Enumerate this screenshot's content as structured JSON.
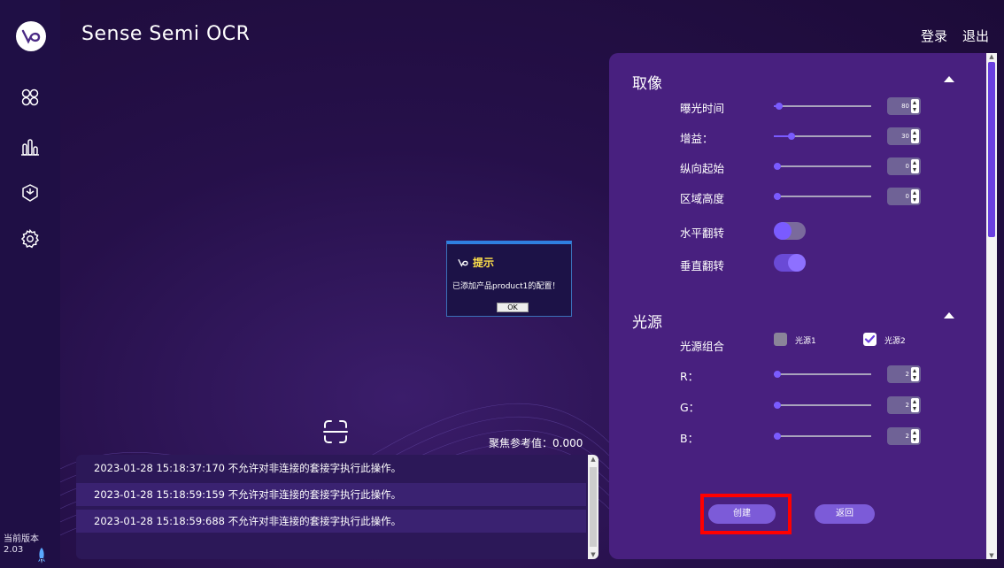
{
  "header": {
    "title": "Sense Semi OCR",
    "login": "登录",
    "logout": "退出"
  },
  "sidebar": {
    "items": [
      {
        "name": "dashboard",
        "icon": "clover-icon"
      },
      {
        "name": "statistics",
        "icon": "bar-chart-icon"
      },
      {
        "name": "products",
        "icon": "box-icon"
      },
      {
        "name": "settings",
        "icon": "gear-icon"
      }
    ],
    "version_label": "当前版本",
    "version": "2.03"
  },
  "dialog": {
    "title": "提示",
    "message": "已添加产品product1的配置！",
    "ok": "OK"
  },
  "focus": {
    "label": "聚焦参考值：0.000"
  },
  "log": {
    "rows": [
      "2023-01-28 15:18:37:170  不允许对非连接的套接字执行此操作。",
      "2023-01-28 15:18:59:159  不允许对非连接的套接字执行此操作。",
      "2023-01-28 15:18:59:688  不允许对非连接的套接字执行此操作。"
    ]
  },
  "panel": {
    "capture": {
      "title": "取像",
      "rows": [
        {
          "label": "曝光时间",
          "value": "80",
          "level": 0.02
        },
        {
          "label": "增益：",
          "value": "30",
          "level": 0.15
        },
        {
          "label": "纵向起始",
          "value": "0",
          "level": 0.0
        },
        {
          "label": "区域高度",
          "value": "0",
          "level": 0.0
        }
      ],
      "flip_h": {
        "label": "水平翻转",
        "on": false
      },
      "flip_v": {
        "label": "垂直翻转",
        "on": true
      }
    },
    "light": {
      "title": "光源",
      "combo_label": "光源组合",
      "options": [
        {
          "label": "光源1",
          "checked": false
        },
        {
          "label": "光源2",
          "checked": true
        }
      ],
      "rows": [
        {
          "label": "R：",
          "value": "2",
          "level": 0.0
        },
        {
          "label": "G：",
          "value": "2",
          "level": 0.0
        },
        {
          "label": "B：",
          "value": "2",
          "level": 0.0
        }
      ]
    },
    "create": "创建",
    "back": "返回"
  },
  "colors": {
    "accent": "#7a5bff",
    "panel": "#48207f",
    "highlight": "#ff0000",
    "dialog_title": "#ffe14a"
  }
}
